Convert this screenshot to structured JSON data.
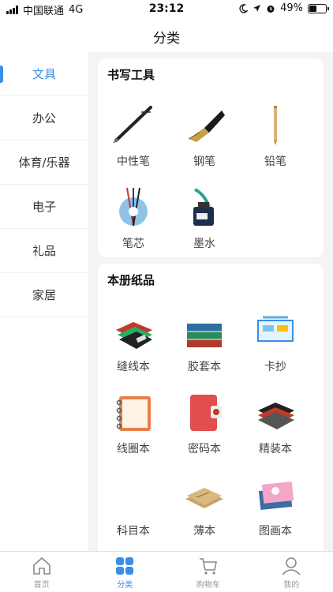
{
  "status": {
    "carrier": "中国联通",
    "network": "4G",
    "time": "23:12",
    "battery": "49%",
    "battery_level": 0.49
  },
  "header": {
    "title": "分类"
  },
  "sidebar": {
    "items": [
      {
        "label": "文具",
        "active": true
      },
      {
        "label": "办公"
      },
      {
        "label": "体育/乐器"
      },
      {
        "label": "电子"
      },
      {
        "label": "礼品"
      },
      {
        "label": "家居"
      }
    ]
  },
  "sections": [
    {
      "title": "书写工具",
      "items": [
        {
          "label": "中性笔",
          "icon": "gel-pen-icon"
        },
        {
          "label": "钢笔",
          "icon": "fountain-pen-icon"
        },
        {
          "label": "铅笔",
          "icon": "pencil-icon"
        },
        {
          "label": "笔芯",
          "icon": "pen-refill-icon"
        },
        {
          "label": "墨水",
          "icon": "ink-bottle-icon"
        }
      ]
    },
    {
      "title": "本册纸品",
      "items": [
        {
          "label": "缝线本",
          "icon": "sewn-notebook-icon"
        },
        {
          "label": "胶套本",
          "icon": "glued-notebook-icon"
        },
        {
          "label": "卡抄",
          "icon": "card-stand-icon"
        },
        {
          "label": "线圈本",
          "icon": "spiral-notebook-icon"
        },
        {
          "label": "密码本",
          "icon": "lock-diary-icon"
        },
        {
          "label": "精装本",
          "icon": "hardcover-book-icon"
        },
        {
          "label": "科目本",
          "icon": "subject-notebook-icon"
        },
        {
          "label": "薄本",
          "icon": "thin-notebook-icon"
        },
        {
          "label": "图画本",
          "icon": "drawing-book-icon"
        }
      ]
    }
  ],
  "tabbar": {
    "items": [
      {
        "label": "首页",
        "icon": "home-icon"
      },
      {
        "label": "分类",
        "icon": "category-grid-icon",
        "active": true
      },
      {
        "label": "购物车",
        "icon": "cart-icon"
      },
      {
        "label": "我的",
        "icon": "user-icon"
      }
    ]
  },
  "colors": {
    "accent": "#3a8ee6",
    "background": "#f4f4f4"
  }
}
